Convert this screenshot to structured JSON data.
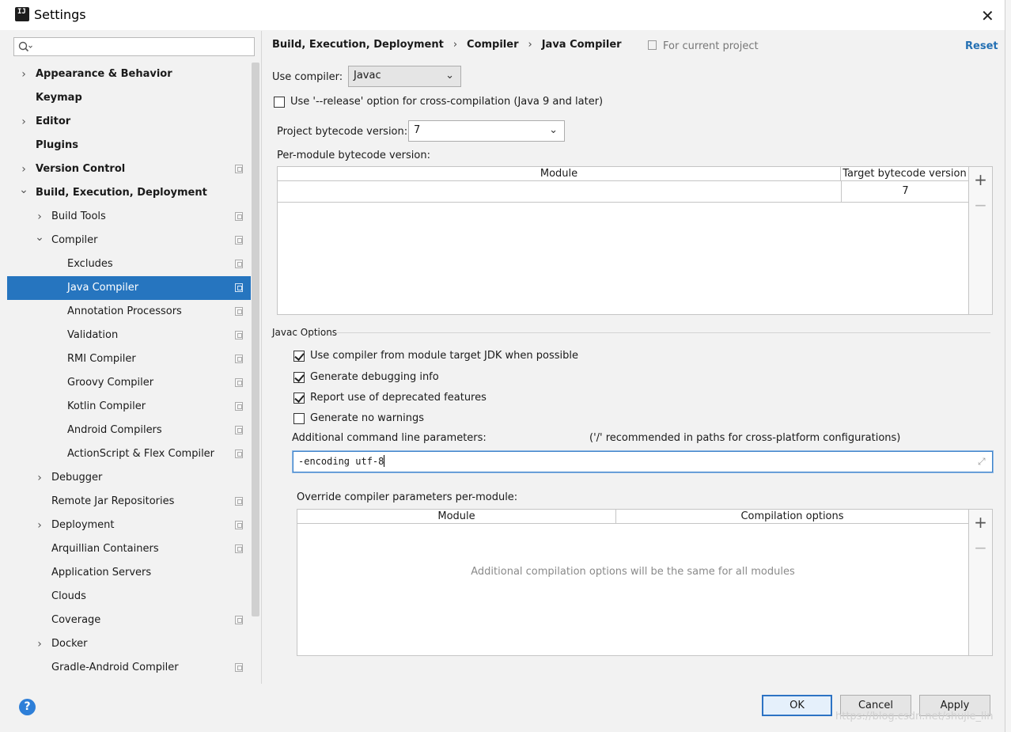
{
  "window": {
    "title": "Settings",
    "close_symbol": "✕"
  },
  "search": {
    "placeholder": ""
  },
  "sidebar": {
    "items": [
      {
        "label": "Appearance & Behavior",
        "level": 0,
        "expandable": true,
        "expanded": false,
        "bold": true,
        "project": false
      },
      {
        "label": "Keymap",
        "level": 0,
        "expandable": false,
        "bold": true,
        "project": false
      },
      {
        "label": "Editor",
        "level": 0,
        "expandable": true,
        "expanded": false,
        "bold": true,
        "project": false
      },
      {
        "label": "Plugins",
        "level": 0,
        "expandable": false,
        "bold": true,
        "project": false
      },
      {
        "label": "Version Control",
        "level": 0,
        "expandable": true,
        "expanded": false,
        "bold": true,
        "project": true
      },
      {
        "label": "Build, Execution, Deployment",
        "level": 0,
        "expandable": true,
        "expanded": true,
        "bold": true,
        "project": false
      },
      {
        "label": "Build Tools",
        "level": 1,
        "expandable": true,
        "expanded": false,
        "project": true
      },
      {
        "label": "Compiler",
        "level": 1,
        "expandable": true,
        "expanded": true,
        "project": true
      },
      {
        "label": "Excludes",
        "level": 2,
        "expandable": false,
        "project": true
      },
      {
        "label": "Java Compiler",
        "level": 2,
        "expandable": false,
        "project": true,
        "selected": true
      },
      {
        "label": "Annotation Processors",
        "level": 2,
        "expandable": false,
        "project": true
      },
      {
        "label": "Validation",
        "level": 2,
        "expandable": false,
        "project": true
      },
      {
        "label": "RMI Compiler",
        "level": 2,
        "expandable": false,
        "project": true
      },
      {
        "label": "Groovy Compiler",
        "level": 2,
        "expandable": false,
        "project": true
      },
      {
        "label": "Kotlin Compiler",
        "level": 2,
        "expandable": false,
        "project": true
      },
      {
        "label": "Android Compilers",
        "level": 2,
        "expandable": false,
        "project": true
      },
      {
        "label": "ActionScript & Flex Compiler",
        "level": 2,
        "expandable": false,
        "project": true
      },
      {
        "label": "Debugger",
        "level": 1,
        "expandable": true,
        "expanded": false,
        "project": false
      },
      {
        "label": "Remote Jar Repositories",
        "level": 1,
        "expandable": false,
        "project": true
      },
      {
        "label": "Deployment",
        "level": 1,
        "expandable": true,
        "expanded": false,
        "project": true
      },
      {
        "label": "Arquillian Containers",
        "level": 1,
        "expandable": false,
        "project": true
      },
      {
        "label": "Application Servers",
        "level": 1,
        "expandable": false,
        "project": false
      },
      {
        "label": "Clouds",
        "level": 1,
        "expandable": false,
        "project": false
      },
      {
        "label": "Coverage",
        "level": 1,
        "expandable": false,
        "project": true
      },
      {
        "label": "Docker",
        "level": 1,
        "expandable": true,
        "expanded": false,
        "project": false
      },
      {
        "label": "Gradle-Android Compiler",
        "level": 1,
        "expandable": false,
        "project": true
      }
    ]
  },
  "breadcrumb": {
    "parts": [
      "Build, Execution, Deployment",
      "Compiler",
      "Java Compiler"
    ],
    "separator": "›",
    "scope": "For current project",
    "reset_label": "Reset"
  },
  "compiler": {
    "use_compiler_label": "Use compiler:",
    "use_compiler_value": "Javac",
    "release_option_label": "Use '--release' option for cross-compilation (Java 9 and later)",
    "release_option_checked": false,
    "bytecode_label": "Project bytecode version:",
    "bytecode_value": "7",
    "per_module_label": "Per-module bytecode version:",
    "module_table": {
      "headers": [
        "Module",
        "Target bytecode version"
      ],
      "rows": [
        {
          "module": "",
          "target": "7"
        }
      ]
    }
  },
  "javac": {
    "group_title": "Javac Options",
    "options": [
      {
        "label": "Use compiler from module target JDK when possible",
        "checked": true
      },
      {
        "label": "Generate debugging info",
        "checked": true
      },
      {
        "label": "Report use of deprecated features",
        "checked": true
      },
      {
        "label": "Generate no warnings",
        "checked": false
      }
    ],
    "cmd_label": "Additional command line parameters:",
    "cmd_hint": "('/' recommended in paths for cross-platform configurations)",
    "cmd_value": "-encoding utf-8",
    "override_label": "Override compiler parameters per-module:",
    "override_table": {
      "headers": [
        "Module",
        "Compilation options"
      ],
      "empty_text": "Additional compilation options will be the same for all modules"
    }
  },
  "buttons": {
    "ok": "OK",
    "cancel": "Cancel",
    "apply": "Apply",
    "help": "?"
  },
  "icons": {
    "add": "+",
    "remove": "−",
    "chevron_right": "›",
    "chevron_down": "⌄",
    "combo_arrow": "⌄"
  },
  "watermark": "https://blog.csdn.net/shujie_lin",
  "colors": {
    "selection": "#2675bf",
    "link": "#2470b3",
    "help": "#2e7fd8"
  }
}
